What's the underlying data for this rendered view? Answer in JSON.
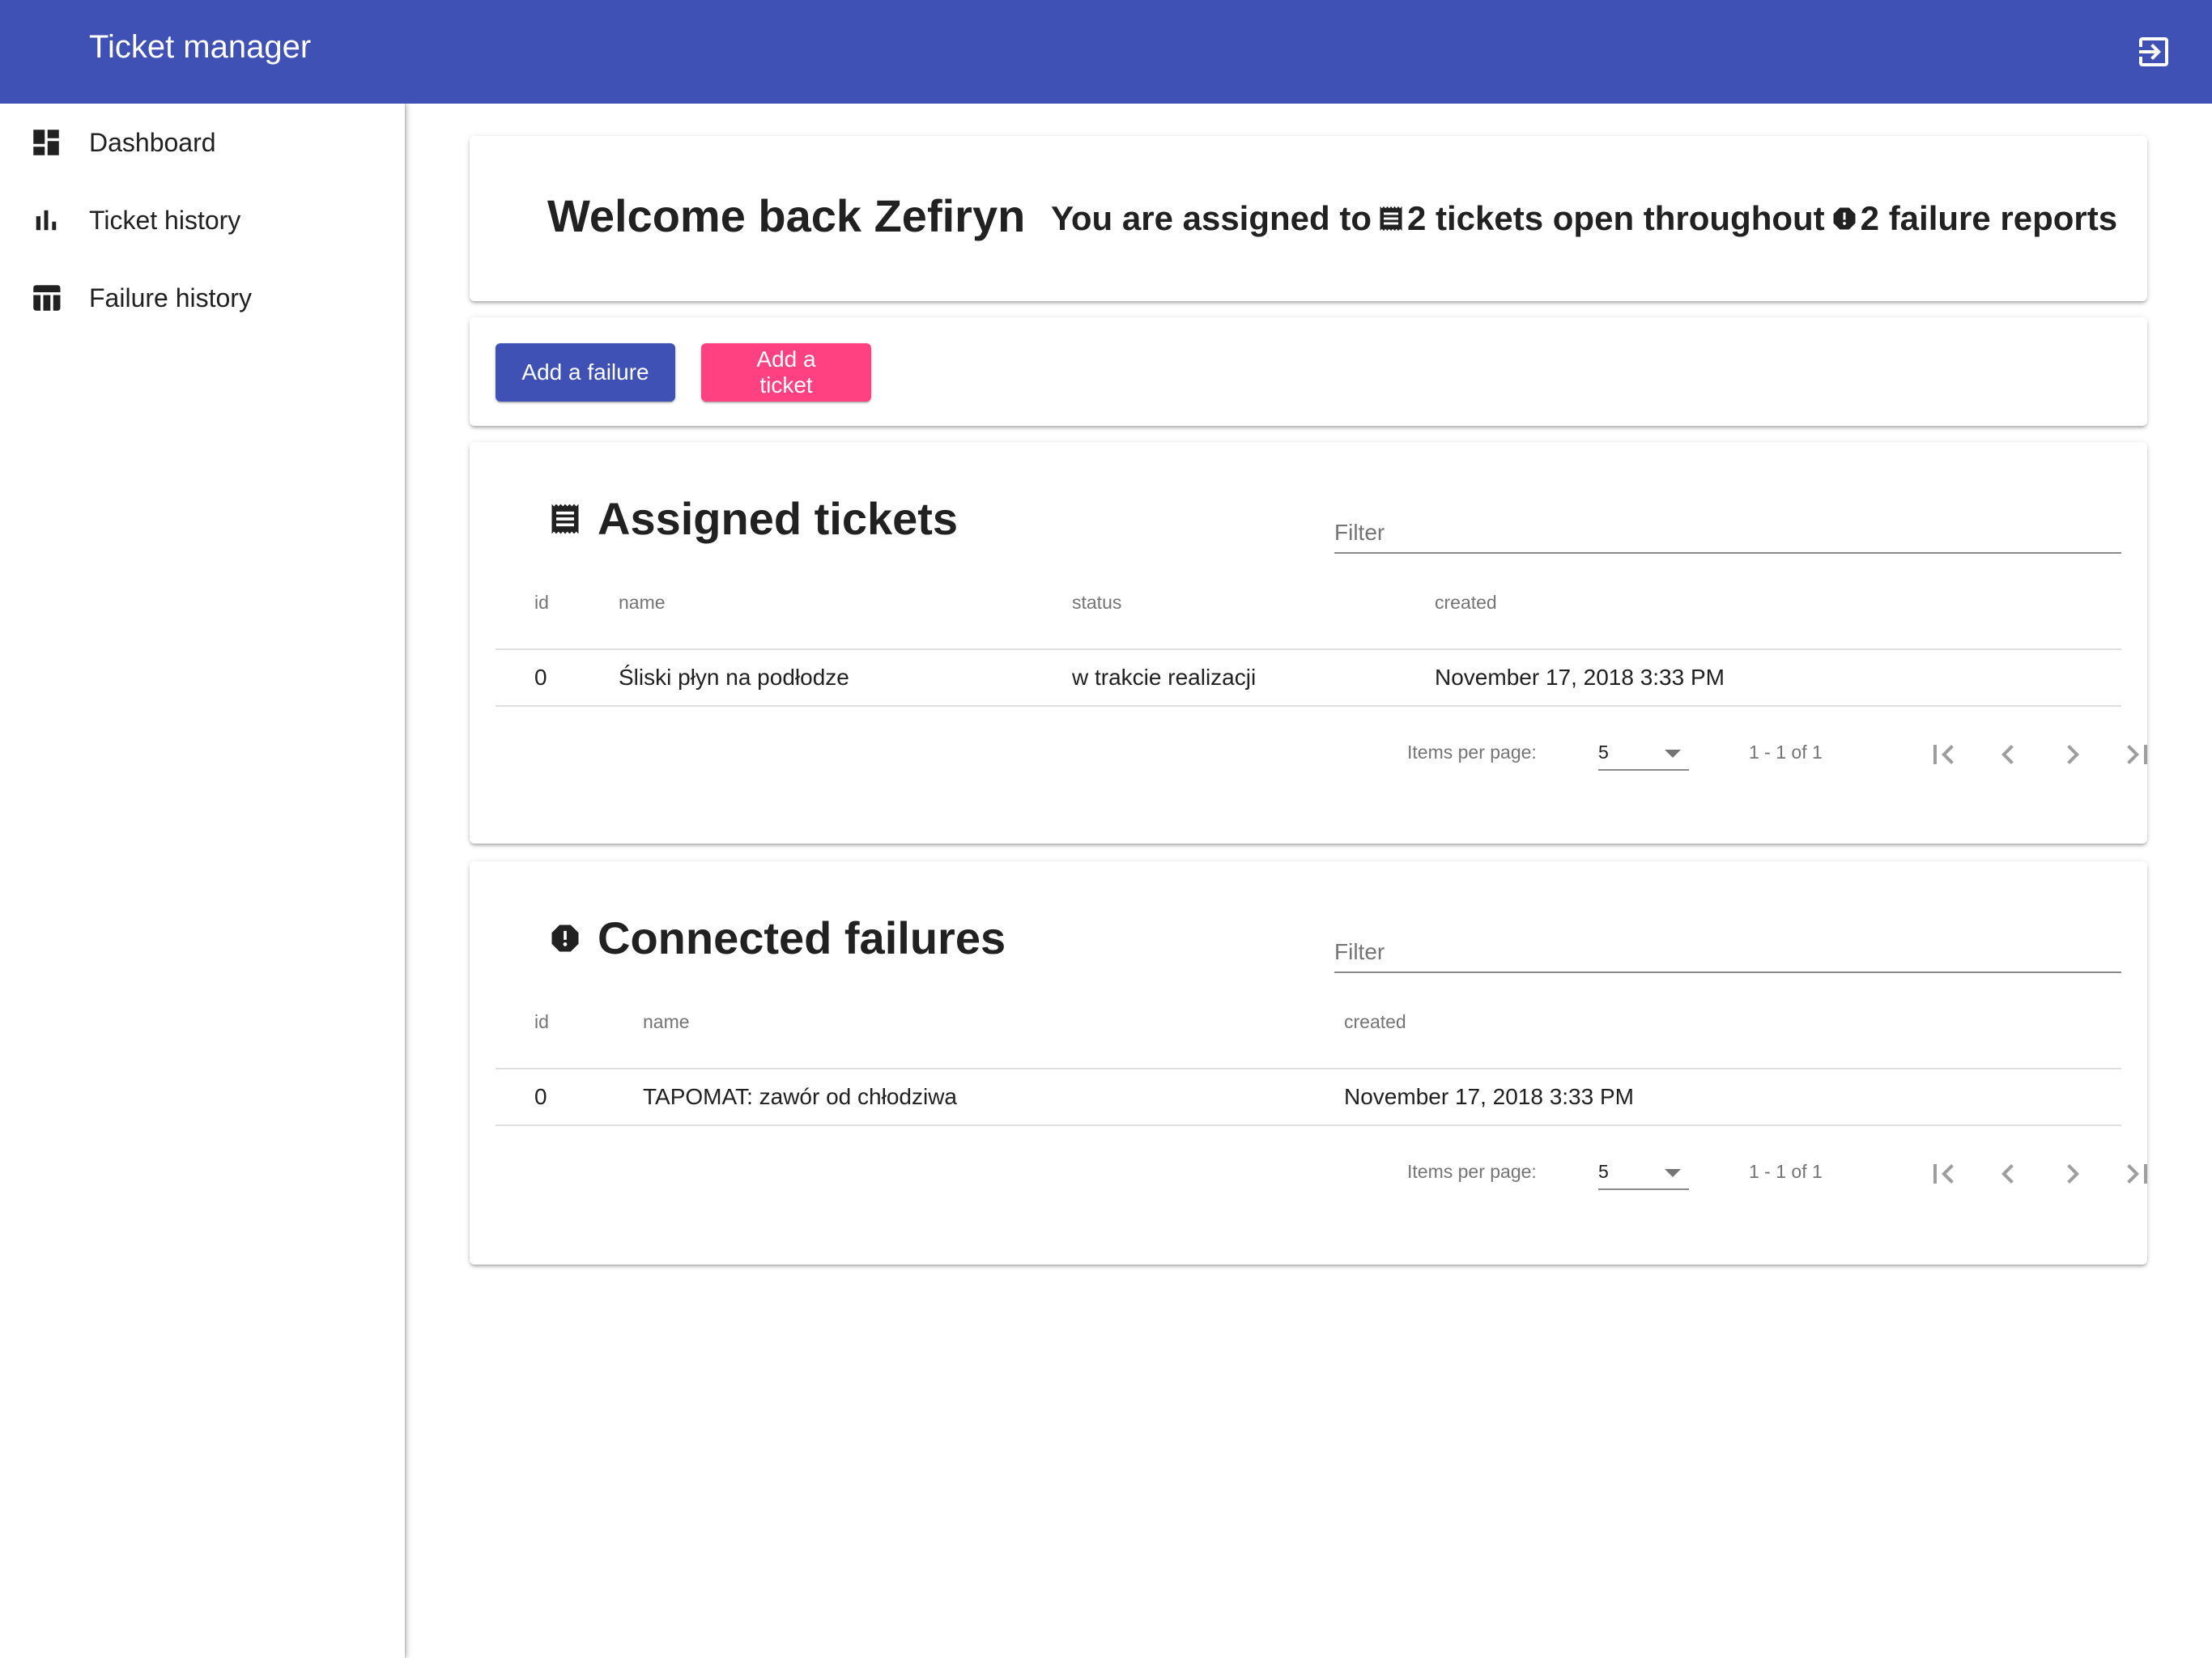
{
  "app": {
    "title": "Ticket manager",
    "colors": {
      "primary": "#3f51b5",
      "accent": "#ff4081"
    },
    "logout_icon": "exit-to-app-icon"
  },
  "sidebar": {
    "items": [
      {
        "label": "Dashboard",
        "icon": "dashboard-icon"
      },
      {
        "label": "Ticket history",
        "icon": "bar-chart-icon"
      },
      {
        "label": "Failure history",
        "icon": "table-icon"
      }
    ]
  },
  "welcome": {
    "title": "Welcome back Zefiryn",
    "assigned_prefix": "You are assigned to",
    "tickets_text": "2 tickets open throughout",
    "failures_text": "2 failure reports"
  },
  "actions": {
    "add_failure": "Add a failure",
    "add_ticket": "Add a ticket"
  },
  "tickets": {
    "title": "Assigned tickets",
    "filter_placeholder": "Filter",
    "columns": {
      "id": "id",
      "name": "name",
      "status": "status",
      "created": "created"
    },
    "rows": [
      {
        "id": "0",
        "name": "Śliski płyn na podłodze",
        "status": "w trakcie realizacji",
        "created": "November 17, 2018 3:33 PM"
      }
    ],
    "paginator": {
      "items_per_page_label": "Items per page:",
      "page_size": "5",
      "range": "1 - 1 of 1"
    }
  },
  "failures": {
    "title": "Connected failures",
    "filter_placeholder": "Filter",
    "columns": {
      "id": "id",
      "name": "name",
      "created": "created"
    },
    "rows": [
      {
        "id": "0",
        "name": "TAPOMAT: zawór od chłodziwa",
        "created": "November 17, 2018 3:33 PM"
      }
    ],
    "paginator": {
      "items_per_page_label": "Items per page:",
      "page_size": "5",
      "range": "1 - 1 of 1"
    }
  }
}
